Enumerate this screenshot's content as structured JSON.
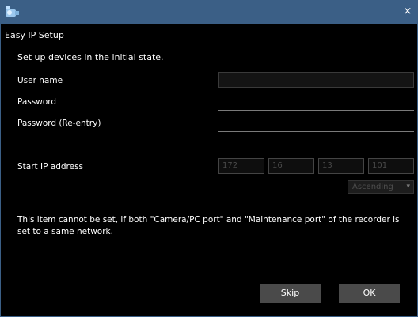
{
  "window": {
    "title_bar_color": "#3b5f86",
    "close_icon": "×"
  },
  "dialog": {
    "title": "Easy IP Setup",
    "instruction": "Set up devices in the initial state."
  },
  "fields": {
    "user_name_label": "User name",
    "user_name_value": "",
    "password_label": "Password",
    "password_value": "",
    "password_reentry_label": "Password (Re-entry)",
    "password_reentry_value": "",
    "start_ip_label": "Start IP address",
    "ip_octets": [
      "172",
      "16",
      "13",
      "101"
    ]
  },
  "order": {
    "selected": "Ascending",
    "chevron": "▾"
  },
  "note": "This item cannot be set, if both \"Camera/PC port\" and \"Maintenance port\" of the recorder is set to a same network.",
  "buttons": {
    "skip_label": "Skip",
    "ok_label": "OK"
  }
}
